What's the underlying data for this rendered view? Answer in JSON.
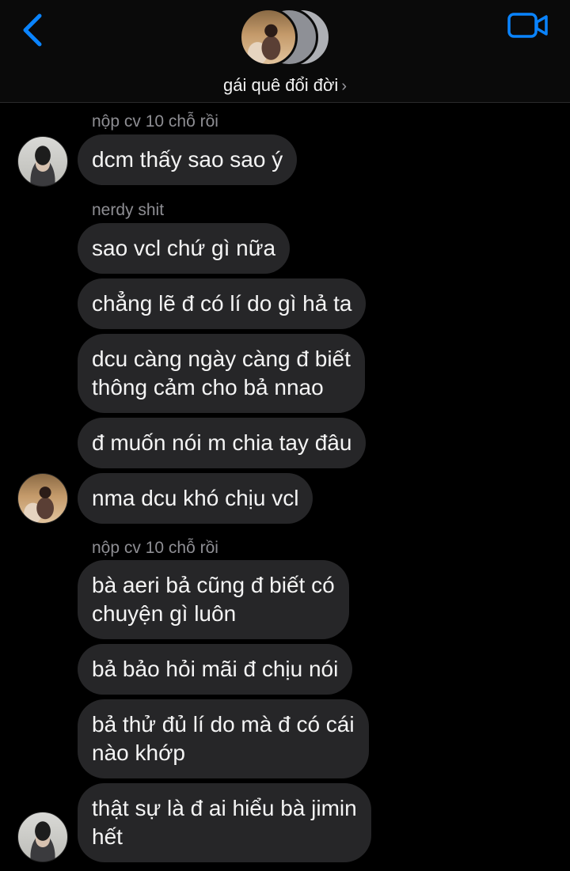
{
  "header": {
    "group_name": "gái quê đổi đời",
    "chevron": "›",
    "accent": "#0a84ff"
  },
  "messages": [
    {
      "sender": "nộp cv 10 chỗ rồi",
      "text": "dcm thấy sao sao ý"
    },
    {
      "sender": "nerdy shit",
      "text": "sao vcl chứ gì nữa"
    },
    {
      "text": "chẳng lẽ đ có lí do gì hả ta"
    },
    {
      "text_lines": [
        "dcu càng ngày càng đ biết",
        "thông cảm cho bả nnao"
      ]
    },
    {
      "text": "đ muốn nói m chia tay đâu"
    },
    {
      "text": "nma dcu khó chịu vcl"
    },
    {
      "sender": "nộp cv 10 chỗ rồi",
      "text_lines": [
        "bà aeri bả cũng đ biết có",
        "chuyện gì luôn"
      ]
    },
    {
      "text": "bả bảo hỏi mãi đ chịu nói"
    },
    {
      "text_lines": [
        "bả thử đủ lí do mà đ có cái",
        "nào khớp"
      ]
    },
    {
      "text_lines": [
        "thật sự là đ ai hiểu bà jimin",
        "hết"
      ]
    }
  ]
}
